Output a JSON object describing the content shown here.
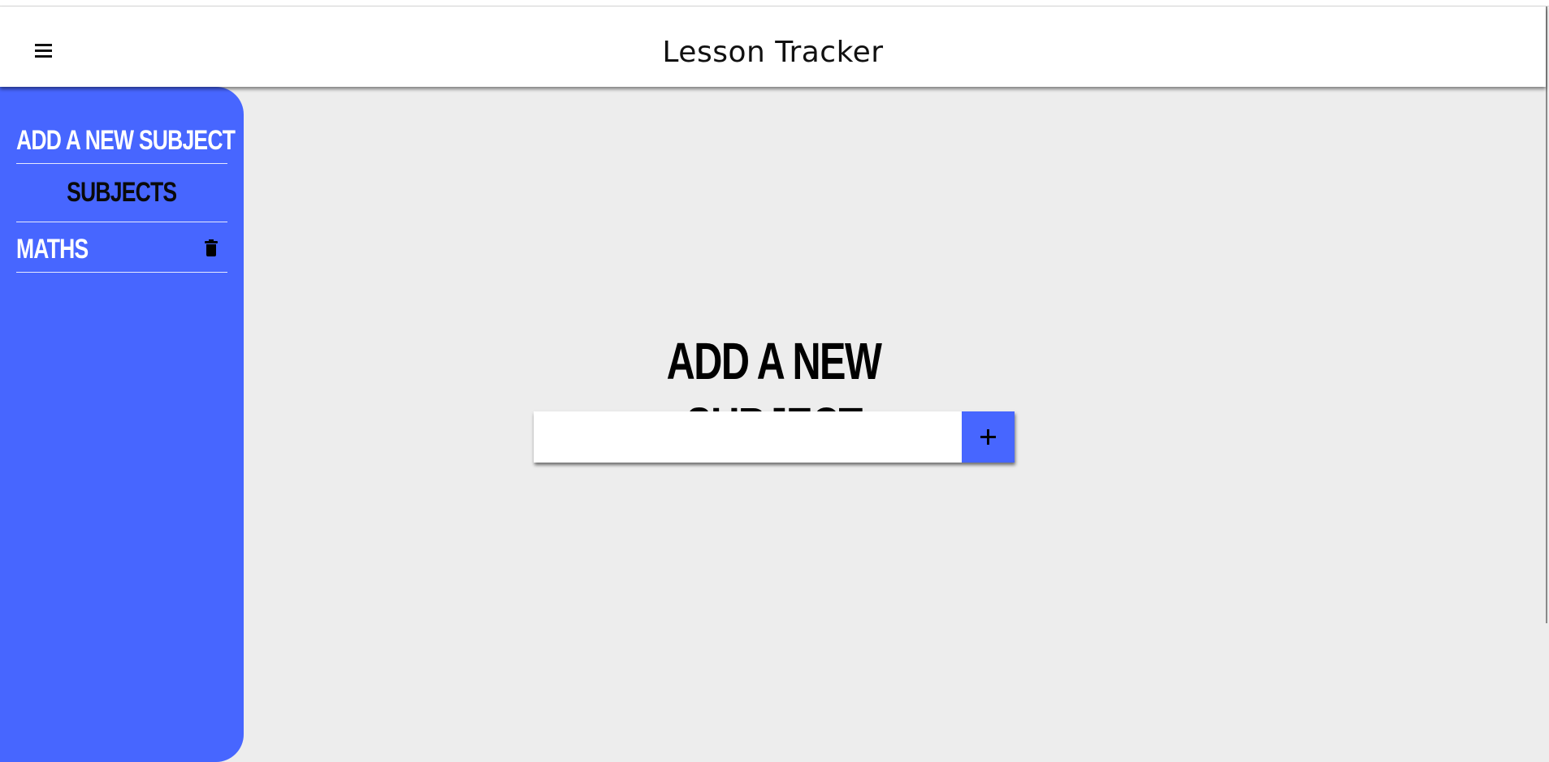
{
  "header": {
    "title": "Lesson Tracker",
    "menu_icon": "hamburger-menu-icon"
  },
  "sidebar": {
    "add_new_label": "ADD A NEW SUBJECT",
    "section_heading": "SUBJECTS",
    "subjects": [
      {
        "name": "MATHS",
        "action_icon": "trash-icon"
      }
    ]
  },
  "main": {
    "heading": "ADD A NEW SUBJECT",
    "input": {
      "value": "",
      "placeholder": ""
    },
    "add_button_icon": "plus-icon"
  },
  "colors": {
    "accent": "#4766ff",
    "background": "#ededed",
    "header_background": "#ffffff"
  }
}
